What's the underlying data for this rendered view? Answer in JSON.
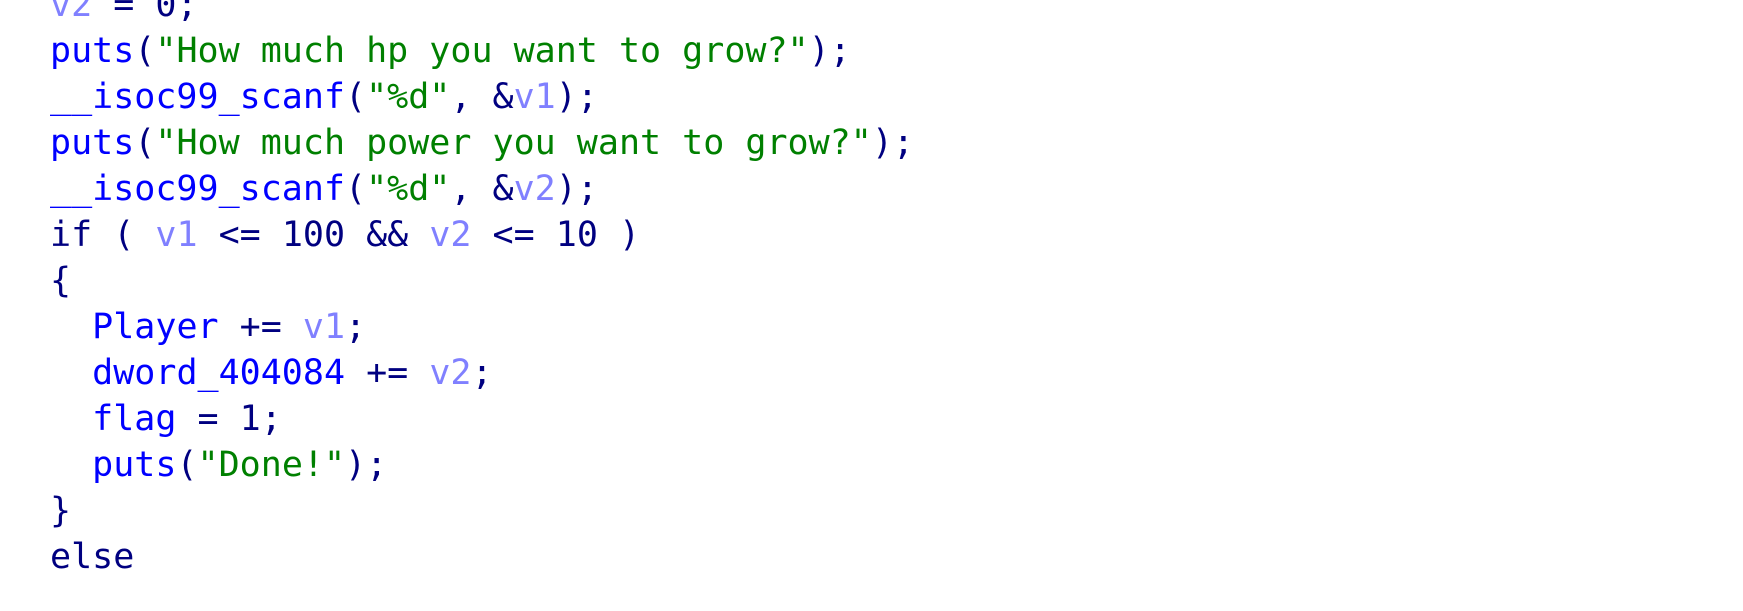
{
  "colors": {
    "identifier": "#0000ff",
    "function": "#0000ff",
    "string": "#008000",
    "variable": "#8080ff",
    "punctuation": "#000080",
    "number": "#000080",
    "keyword": "#000080",
    "background": "#ffffff"
  },
  "code": {
    "lines": [
      [
        {
          "t": "v2",
          "c": "variable"
        },
        {
          "t": " = 0;",
          "c": "punctuation"
        }
      ],
      [
        {
          "t": "puts",
          "c": "function"
        },
        {
          "t": "(",
          "c": "punctuation"
        },
        {
          "t": "\"How much hp you want to grow?\"",
          "c": "string"
        },
        {
          "t": ");",
          "c": "punctuation"
        }
      ],
      [
        {
          "t": "__isoc99_scanf",
          "c": "function"
        },
        {
          "t": "(",
          "c": "punctuation"
        },
        {
          "t": "\"%d\"",
          "c": "string"
        },
        {
          "t": ", &",
          "c": "punctuation"
        },
        {
          "t": "v1",
          "c": "variable"
        },
        {
          "t": ");",
          "c": "punctuation"
        }
      ],
      [
        {
          "t": "puts",
          "c": "function"
        },
        {
          "t": "(",
          "c": "punctuation"
        },
        {
          "t": "\"How much power you want to grow?\"",
          "c": "string"
        },
        {
          "t": ");",
          "c": "punctuation"
        }
      ],
      [
        {
          "t": "__isoc99_scanf",
          "c": "function"
        },
        {
          "t": "(",
          "c": "punctuation"
        },
        {
          "t": "\"%d\"",
          "c": "string"
        },
        {
          "t": ", &",
          "c": "punctuation"
        },
        {
          "t": "v2",
          "c": "variable"
        },
        {
          "t": ");",
          "c": "punctuation"
        }
      ],
      [
        {
          "t": "if",
          "c": "keyword"
        },
        {
          "t": " ( ",
          "c": "punctuation"
        },
        {
          "t": "v1",
          "c": "variable"
        },
        {
          "t": " <= 100 && ",
          "c": "punctuation"
        },
        {
          "t": "v2",
          "c": "variable"
        },
        {
          "t": " <= 10 )",
          "c": "punctuation"
        }
      ],
      [
        {
          "t": "{",
          "c": "punctuation"
        }
      ],
      [
        {
          "t": "  ",
          "c": "punctuation"
        },
        {
          "t": "Player",
          "c": "identifier"
        },
        {
          "t": " += ",
          "c": "punctuation"
        },
        {
          "t": "v1",
          "c": "variable"
        },
        {
          "t": ";",
          "c": "punctuation"
        }
      ],
      [
        {
          "t": "  ",
          "c": "punctuation"
        },
        {
          "t": "dword_404084",
          "c": "identifier"
        },
        {
          "t": " += ",
          "c": "punctuation"
        },
        {
          "t": "v2",
          "c": "variable"
        },
        {
          "t": ";",
          "c": "punctuation"
        }
      ],
      [
        {
          "t": "  ",
          "c": "punctuation"
        },
        {
          "t": "flag",
          "c": "identifier"
        },
        {
          "t": " = 1;",
          "c": "punctuation"
        }
      ],
      [
        {
          "t": "  ",
          "c": "punctuation"
        },
        {
          "t": "puts",
          "c": "function"
        },
        {
          "t": "(",
          "c": "punctuation"
        },
        {
          "t": "\"Done!\"",
          "c": "string"
        },
        {
          "t": ");",
          "c": "punctuation"
        }
      ],
      [
        {
          "t": "}",
          "c": "punctuation"
        }
      ],
      [
        {
          "t": "else",
          "c": "keyword"
        }
      ]
    ]
  }
}
